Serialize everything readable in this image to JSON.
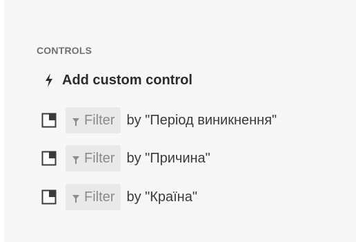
{
  "section": {
    "title": "CONTROLS"
  },
  "add_control": {
    "icon": "lightning-bolt-icon",
    "label": "Add custom control"
  },
  "controls": [
    {
      "icon": "widget-icon",
      "chip_icon": "funnel-icon",
      "chip_label": "Filter",
      "text": "by \"Період виникнення\""
    },
    {
      "icon": "widget-icon",
      "chip_icon": "funnel-icon",
      "chip_label": "Filter",
      "text": "by \"Причина\""
    },
    {
      "icon": "widget-icon",
      "chip_icon": "funnel-icon",
      "chip_label": "Filter",
      "text": "by \"Країна\""
    }
  ],
  "colors": {
    "panel_background": "#f7f7f7",
    "chip_background": "#e9e9e9",
    "heading": "#707070",
    "text": "#3a3a3a"
  }
}
